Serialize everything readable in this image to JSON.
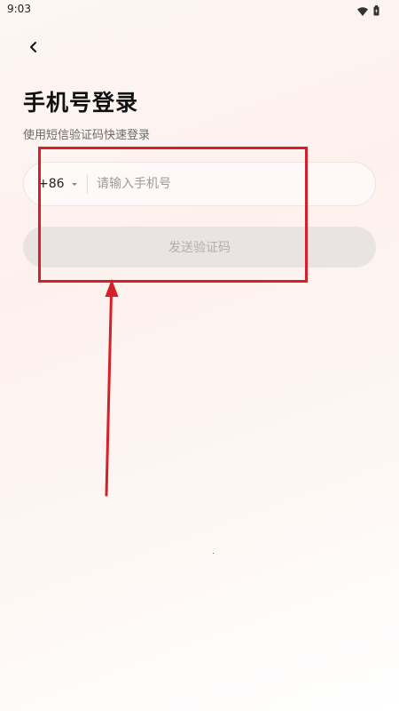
{
  "status_bar": {
    "time": "9:03",
    "icons": [
      "wifi-icon",
      "battery-icon"
    ]
  },
  "nav": {
    "back_icon": "chevron-left-icon"
  },
  "header": {
    "title": "手机号登录",
    "subtitle": "使用短信验证码快速登录"
  },
  "phone_field": {
    "country_code": "+86",
    "placeholder": "请输入手机号",
    "value": ""
  },
  "send_button": {
    "label": "发送验证码",
    "enabled": false
  },
  "annotation": {
    "color": "#d61f26"
  },
  "colors": {
    "background": "#fdf3f0",
    "button_disabled": "#e9e3e1",
    "button_text_disabled": "#b2aeac"
  }
}
